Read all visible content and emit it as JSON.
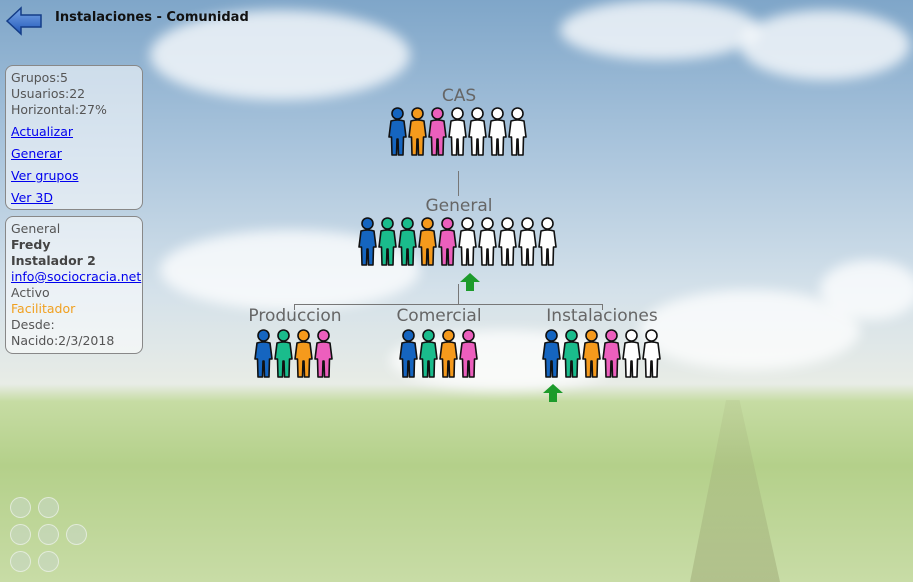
{
  "header": {
    "title": "Instalaciones - Comunidad",
    "back_icon": "back-arrow-icon"
  },
  "stats_panel": {
    "grupos": "Grupos:5",
    "usuarios": "Usuarios:22",
    "horizontal": "Horizontal:27%",
    "links": [
      "Actualizar",
      "Generar",
      "Ver grupos",
      "Ver 3D"
    ]
  },
  "user_panel": {
    "group": "General",
    "name": "Fredy",
    "user": "Instalador 2",
    "email": "info@sociocracia.net",
    "status": "Activo",
    "role": "Facilitador",
    "since": "Desde:",
    "born": "Nacido:2/3/2018"
  },
  "colors": {
    "blue": "#1565c0",
    "teal": "#1abc8c",
    "orange": "#f59a1c",
    "pink": "#ec5fbd",
    "white": "#ffffff",
    "arrow": "#1d9b2b"
  },
  "groups": [
    {
      "name": "CAS",
      "members": [
        "blue",
        "orange",
        "pink",
        "white",
        "white",
        "white",
        "white"
      ]
    },
    {
      "name": "General",
      "members": [
        "blue",
        "teal",
        "teal",
        "orange",
        "pink",
        "white",
        "white",
        "white",
        "white",
        "white"
      ]
    },
    {
      "name": "Produccion",
      "members": [
        "blue",
        "teal",
        "orange",
        "pink"
      ]
    },
    {
      "name": "Comercial",
      "members": [
        "blue",
        "teal",
        "orange",
        "pink"
      ]
    },
    {
      "name": "Instalaciones",
      "members": [
        "blue",
        "teal",
        "orange",
        "pink",
        "white",
        "white"
      ]
    }
  ]
}
